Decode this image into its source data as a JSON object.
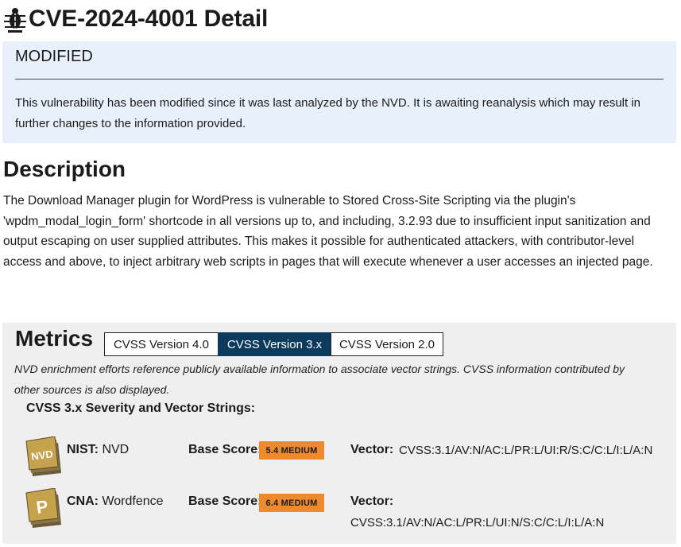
{
  "page": {
    "title": "CVE-2024-4001 Detail"
  },
  "modified": {
    "title": "MODIFIED",
    "text": "This vulnerability has been modified since it was last analyzed by the NVD. It is awaiting reanalysis which may result in further changes to the information provided."
  },
  "description": {
    "heading": "Description",
    "text": "The Download Manager plugin for WordPress is vulnerable to Stored Cross-Site Scripting via the plugin's 'wpdm_modal_login_form' shortcode in all versions up to, and including, 3.2.93 due to insufficient input sanitization and output escaping on user supplied attributes. This makes it possible for authenticated attackers, with contributor-level access and above, to inject arbitrary web scripts in pages that will execute whenever a user accesses an injected page."
  },
  "metrics": {
    "heading": "Metrics",
    "tabs": [
      {
        "label": "CVSS Version 4.0",
        "active": false
      },
      {
        "label": "CVSS Version 3.x",
        "active": true
      },
      {
        "label": "CVSS Version 2.0",
        "active": false
      }
    ],
    "note": "NVD enrichment efforts reference publicly available information to associate vector strings. CVSS information contributed by other sources is also displayed.",
    "severity_heading": "CVSS 3.x Severity and Vector Strings:",
    "base_score_label": "Base Score:",
    "vector_label": "Vector:",
    "rows": [
      {
        "badge_icon": "nvd-badge-icon",
        "badge_text": "NVD",
        "source_label": "NIST:",
        "source_value": "NVD",
        "score": "5.4 MEDIUM",
        "vector": "CVSS:3.1/AV:N/AC:L/PR:L/UI:R/S:C/C:L/I:L/A:N"
      },
      {
        "badge_icon": "cna-badge-icon",
        "badge_text": "P",
        "source_label": "CNA:",
        "source_value": "Wordfence",
        "score": "6.4 MEDIUM",
        "vector": "CVSS:3.1/AV:N/AC:L/PR:L/UI:N/S:C/C:L/I:L/A:N"
      }
    ]
  },
  "colors": {
    "accent": "#0c3a5c",
    "medium": "#ee8a2e",
    "modified_bg": "#e8f1fb",
    "metrics_bg": "#efefef"
  }
}
